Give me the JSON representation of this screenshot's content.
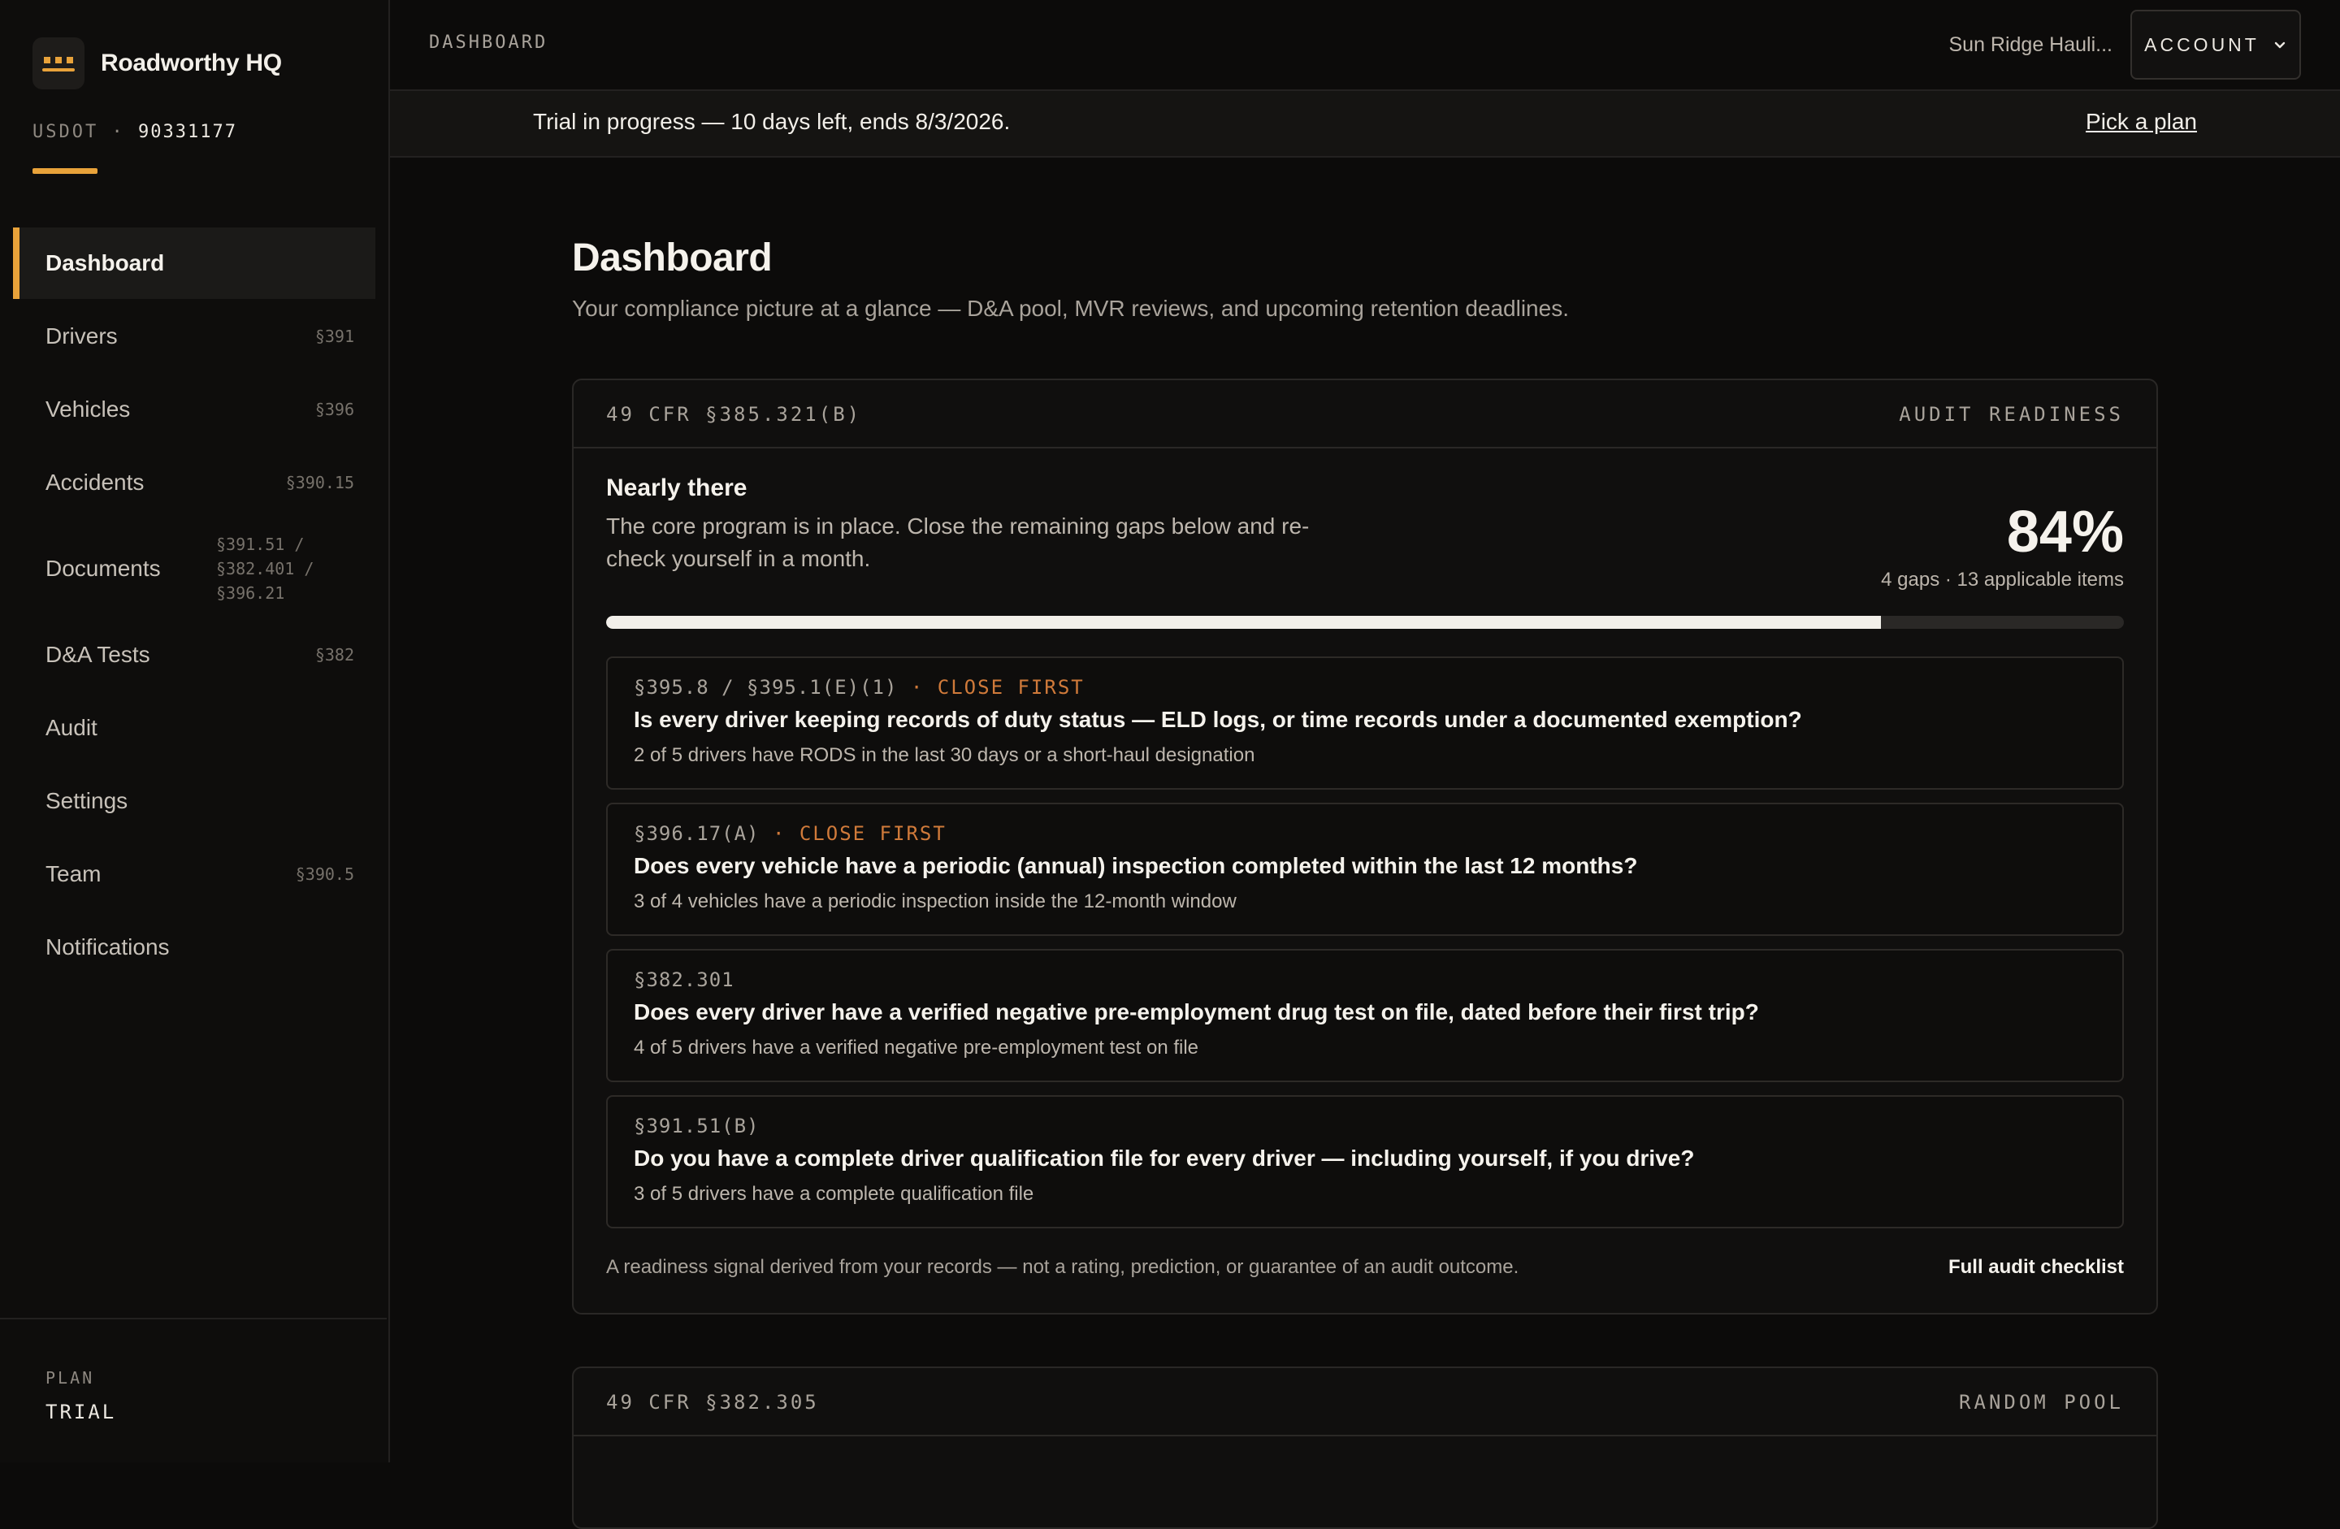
{
  "sidebar": {
    "brand": "Roadworthy HQ",
    "usdot_label": "USDOT",
    "usdot_sep": "·",
    "usdot_number": "90331177",
    "items": [
      {
        "label": "Dashboard",
        "ref": ""
      },
      {
        "label": "Drivers",
        "ref": "§391"
      },
      {
        "label": "Vehicles",
        "ref": "§396"
      },
      {
        "label": "Accidents",
        "ref": "§390.15"
      },
      {
        "label": "Documents",
        "ref": "§391.51 / §382.401 / §396.21"
      },
      {
        "label": "D&A Tests",
        "ref": "§382"
      },
      {
        "label": "Audit",
        "ref": ""
      },
      {
        "label": "Settings",
        "ref": ""
      },
      {
        "label": "Team",
        "ref": "§390.5"
      },
      {
        "label": "Notifications",
        "ref": ""
      }
    ],
    "plan_label": "PLAN",
    "plan_value": "TRIAL"
  },
  "topbar": {
    "breadcrumb": "DASHBOARD",
    "org": "Sun Ridge Hauli...",
    "account": "ACCOUNT"
  },
  "trial": {
    "text": "Trial in progress — 10 days left, ends 8/3/2026.",
    "link": "Pick a plan"
  },
  "page": {
    "title": "Dashboard",
    "subtitle": "Your compliance picture at a glance — D&A pool, MVR reviews, and upcoming retention deadlines."
  },
  "readiness": {
    "cfr": "49 CFR §385.321(B)",
    "tag": "AUDIT READINESS",
    "status_title": "Nearly there",
    "status_desc": "The core program is in place. Close the remaining gaps below and re-check yourself in a month.",
    "percent": "84%",
    "progress_fraction": 0.84,
    "gaps": "4 gaps · 13 applicable items",
    "items": [
      {
        "ref": "§395.8 / §395.1(E)(1)",
        "flag": " · CLOSE FIRST",
        "question": "Is every driver keeping records of duty status — ELD logs, or time records under a documented exemption?",
        "detail": "2 of 5 drivers have RODS in the last 30 days or a short-haul designation"
      },
      {
        "ref": "§396.17(A)",
        "flag": " · CLOSE FIRST",
        "question": "Does every vehicle have a periodic (annual) inspection completed within the last 12 months?",
        "detail": "3 of 4 vehicles have a periodic inspection inside the 12-month window"
      },
      {
        "ref": "§382.301",
        "flag": "",
        "question": "Does every driver have a verified negative pre-employment drug test on file, dated before their first trip?",
        "detail": "4 of 5 drivers have a verified negative pre-employment test on file"
      },
      {
        "ref": "§391.51(B)",
        "flag": "",
        "question": "Do you have a complete driver qualification file for every driver — including yourself, if you drive?",
        "detail": "3 of 5 drivers have a complete qualification file"
      }
    ],
    "footnote": "A readiness signal derived from your records — not a rating, prediction, or guarantee of an audit outcome.",
    "checklist_link": "Full audit checklist"
  },
  "random_pool": {
    "cfr": "49 CFR §382.305",
    "tag": "RANDOM POOL"
  },
  "colors": {
    "accent": "#e8a23a",
    "flag": "#d07a3a",
    "background": "#0c0b0a"
  }
}
